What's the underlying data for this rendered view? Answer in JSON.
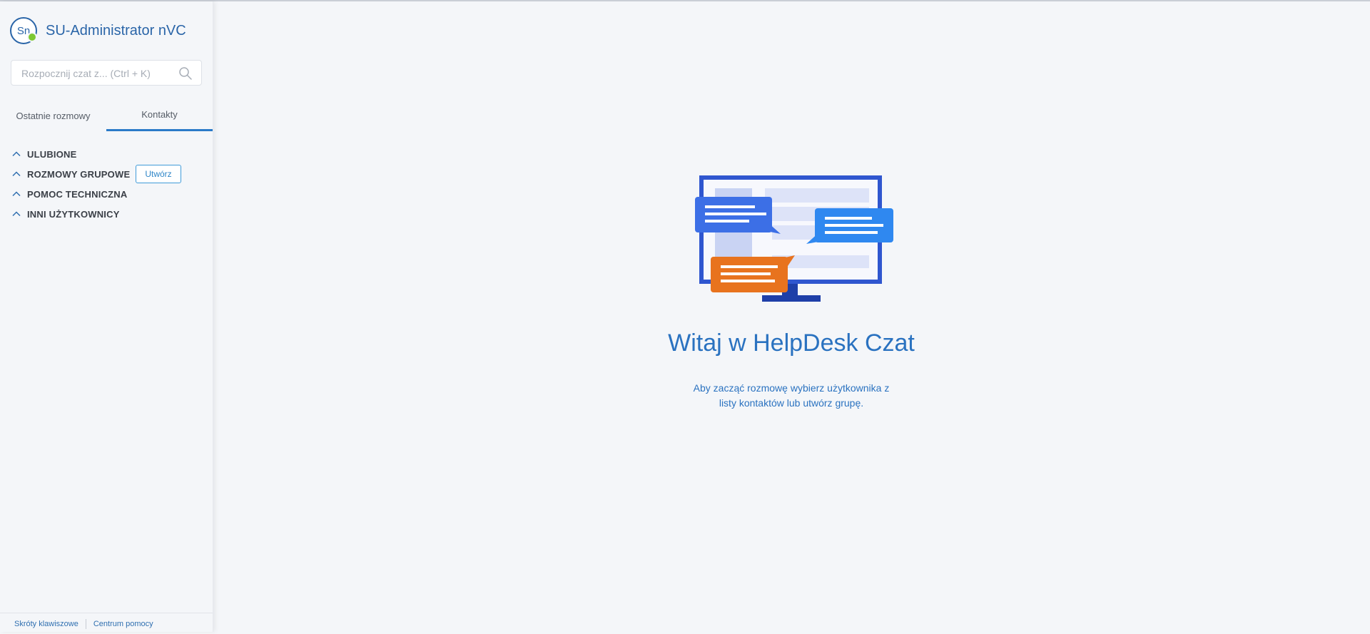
{
  "profile": {
    "initials": "Sn",
    "name": "SU-Administrator nVC",
    "status_color": "#7ec832"
  },
  "search": {
    "placeholder": "Rozpocznij czat z... (Ctrl + K)",
    "value": ""
  },
  "tabs": [
    {
      "label": "Ostatnie rozmowy",
      "active": false
    },
    {
      "label": "Kontakty",
      "active": true
    }
  ],
  "groups": [
    {
      "label": "ULUBIONE"
    },
    {
      "label": "ROZMOWY GRUPOWE",
      "action_label": "Utwórz"
    },
    {
      "label": "POMOC TECHNICZNA"
    },
    {
      "label": "INNI UŻYTKOWNICY"
    }
  ],
  "footer": {
    "shortcuts": "Skróty klawiszowe",
    "help": "Centrum pomocy"
  },
  "main": {
    "title": "Witaj w HelpDesk Czat",
    "subtitle": "Aby zacząć rozmowę wybierz użytkownika z listy kontaktów lub utwórz grupę."
  },
  "colors": {
    "accent": "#2a72c0",
    "orange": "#e8731e",
    "bubble_blue": "#2f6fe0"
  },
  "icons": {
    "search": "search-icon",
    "chevron": "chevron-up-icon",
    "illustration": "monitor-chat-illustration"
  }
}
